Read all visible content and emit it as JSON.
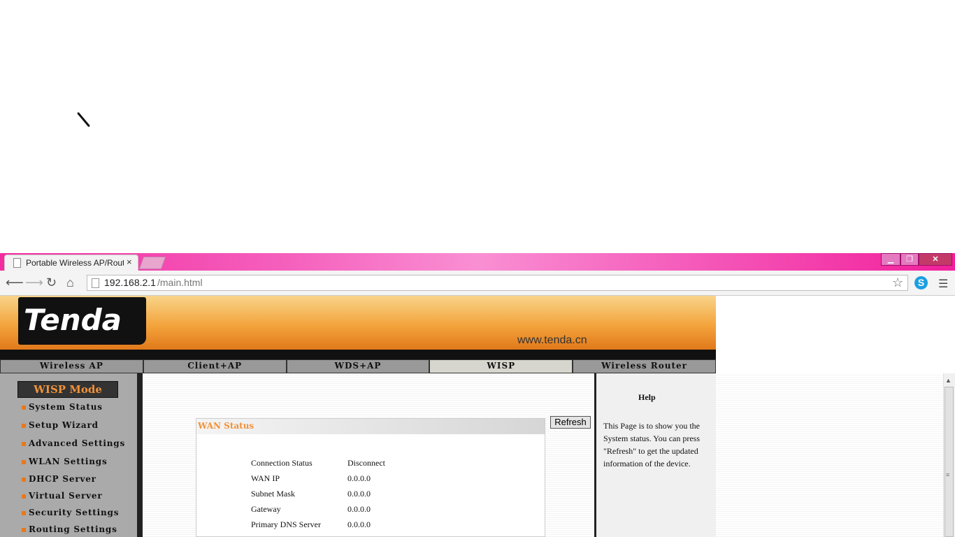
{
  "browser": {
    "tab_title": "Portable Wireless AP/Rout",
    "tab_close": "×",
    "url_host": "192.168.2.1",
    "url_path": "/main.html",
    "window_buttons": {
      "minimize": "▁",
      "maximize": "❐",
      "close": "✕"
    },
    "skype_label": "S"
  },
  "header": {
    "logo": "Tenda",
    "site_url": "www.tenda.cn"
  },
  "modes": [
    "Wireless AP",
    "Client+AP",
    "WDS+AP",
    "WISP",
    "Wireless Router"
  ],
  "active_mode": "WISP",
  "sidebar": {
    "title": "WISP Mode",
    "items": [
      "System Status",
      "Setup Wizard",
      "Advanced Settings",
      "WLAN Settings",
      "DHCP Server",
      "Virtual Server",
      "Security Settings",
      "Routing Settings"
    ]
  },
  "main": {
    "refresh_label": "Refresh",
    "wan_title": "WAN Status",
    "rows": [
      {
        "label": "Connection Status",
        "value": "Disconnect"
      },
      {
        "label": "WAN IP",
        "value": "0.0.0.0"
      },
      {
        "label": "Subnet Mask",
        "value": "0.0.0.0"
      },
      {
        "label": "Gateway",
        "value": "0.0.0.0"
      },
      {
        "label": "Primary DNS Server",
        "value": "0.0.0.0"
      }
    ]
  },
  "help": {
    "title": "Help",
    "text": "This Page is to show you the System status. You can press \"Refresh\" to get the updated information of the device."
  },
  "colors": {
    "accent": "#f0923a",
    "chrome": "#f32ba0"
  }
}
